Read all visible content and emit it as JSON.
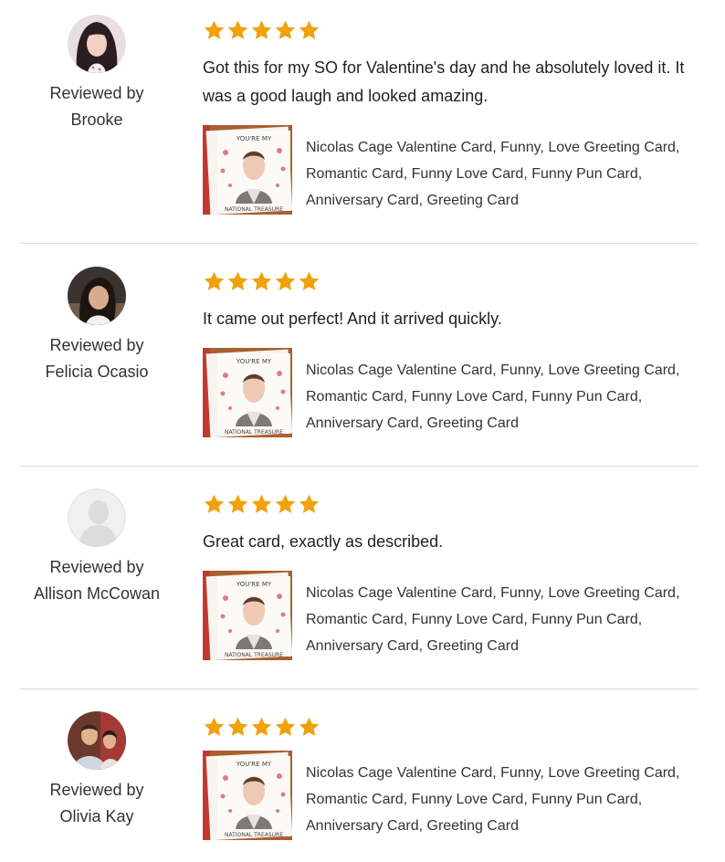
{
  "colors": {
    "star": "#f1a10c",
    "divider": "#d9d9d9"
  },
  "reviews": [
    {
      "reviewed_by_label": "Reviewed by",
      "reviewer_name": "Brooke",
      "rating": 5,
      "text": "Got this for my SO for Valentine's day and he absolutely loved it. It was a good laugh and looked amazing.",
      "product": {
        "title": "Nicolas Cage Valentine Card, Funny, Love Greeting Card, Romantic Card, Funny Love Card, Funny Pun Card, Anniversary Card, Greeting Card",
        "card_top_text": "YOU'RE MY",
        "card_bottom_text": "NATIONAL TREASURE"
      }
    },
    {
      "reviewed_by_label": "Reviewed by",
      "reviewer_name": "Felicia Ocasio",
      "rating": 5,
      "text": "It came out perfect! And it arrived quickly.",
      "product": {
        "title": "Nicolas Cage Valentine Card, Funny, Love Greeting Card, Romantic Card, Funny Love Card, Funny Pun Card, Anniversary Card, Greeting Card",
        "card_top_text": "YOU'RE MY",
        "card_bottom_text": "NATIONAL TREASURE"
      }
    },
    {
      "reviewed_by_label": "Reviewed by",
      "reviewer_name": "Allison McCowan",
      "rating": 5,
      "text": "Great card, exactly as described.",
      "product": {
        "title": "Nicolas Cage Valentine Card, Funny, Love Greeting Card, Romantic Card, Funny Love Card, Funny Pun Card, Anniversary Card, Greeting Card",
        "card_top_text": "YOU'RE MY",
        "card_bottom_text": "NATIONAL TREASURE"
      }
    },
    {
      "reviewed_by_label": "Reviewed by",
      "reviewer_name": "Olivia Kay",
      "rating": 5,
      "text": "",
      "product": {
        "title": "Nicolas Cage Valentine Card, Funny, Love Greeting Card, Romantic Card, Funny Love Card, Funny Pun Card, Anniversary Card, Greeting Card",
        "card_top_text": "YOU'RE MY",
        "card_bottom_text": "NATIONAL TREASURE"
      }
    }
  ]
}
